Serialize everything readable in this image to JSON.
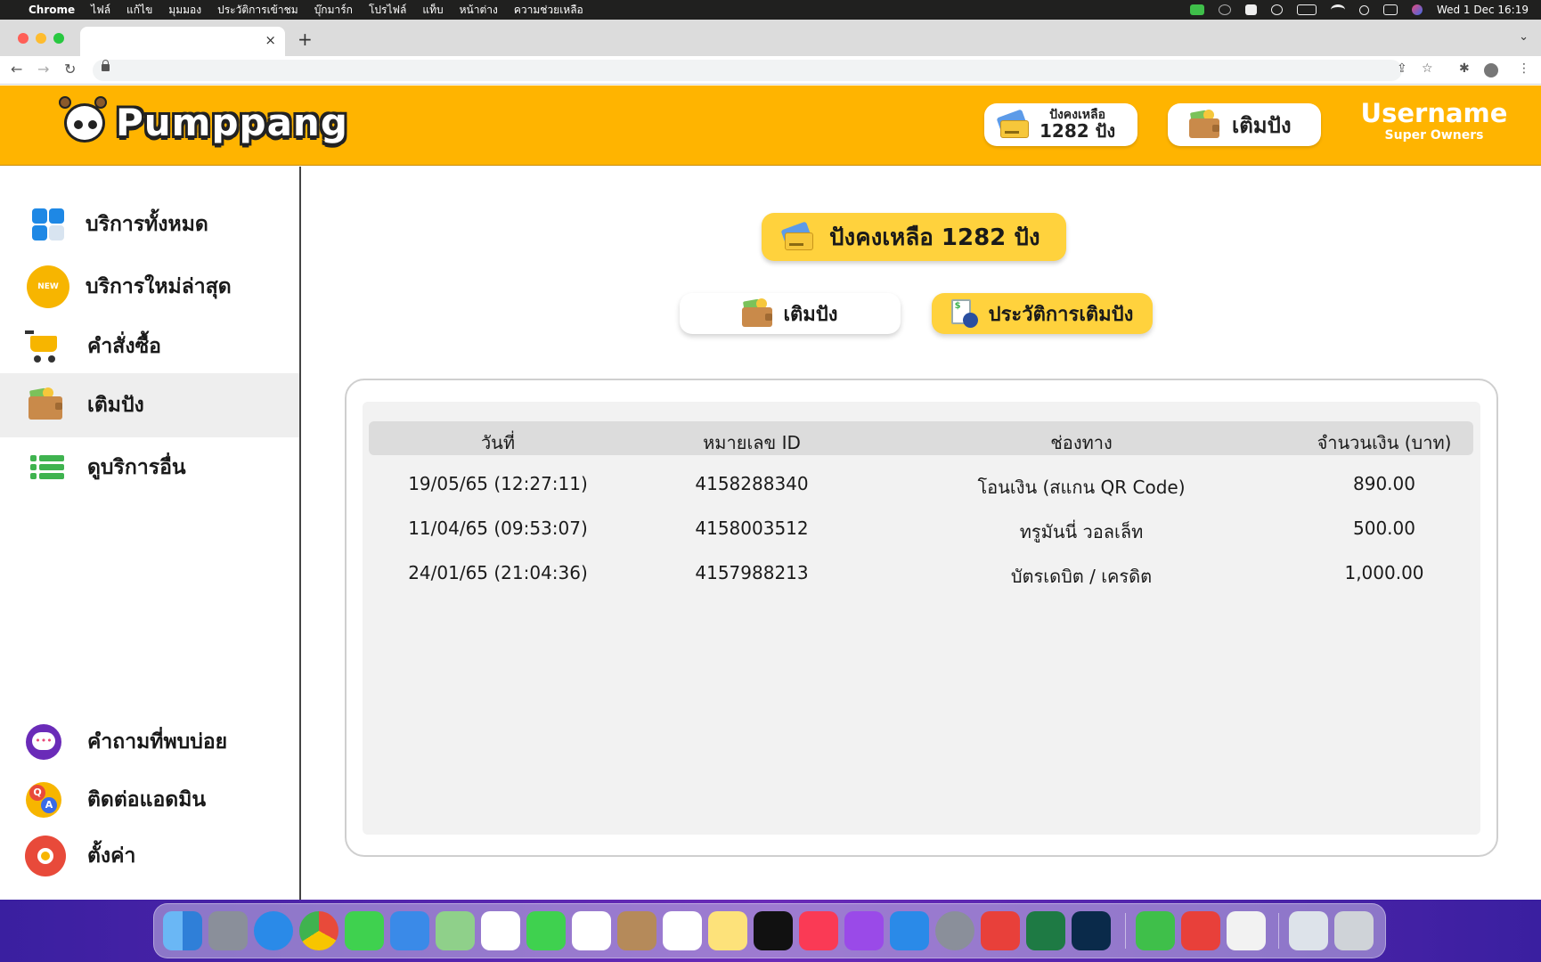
{
  "menubar": {
    "app_name": "Chrome",
    "items": [
      "ไฟล์",
      "แก้ไข",
      "มุมมอง",
      "ประวัติการเข้าชม",
      "บุ๊กมาร์ก",
      "โปรไฟล์",
      "แท็บ",
      "หน้าต่าง",
      "ความช่วยเหลือ"
    ],
    "clock": "Wed 1 Dec  16:19"
  },
  "browser": {
    "tab_close": "×",
    "new_tab": "+"
  },
  "header": {
    "logo_text": "Pumppang",
    "balance_label": "ปังคงเหลือ",
    "balance_value": "1282 ปัง",
    "topup_label": "เติมปัง",
    "username": "Username",
    "role": "Super Owners"
  },
  "sidebar": {
    "items": [
      {
        "label": "บริการทั้งหมด",
        "icon": "grid-icon"
      },
      {
        "label": "บริการใหม่ล่าสุด",
        "icon": "new-badge-icon",
        "badge": "NEW"
      },
      {
        "label": "คำสั่งซื้อ",
        "icon": "cart-icon"
      },
      {
        "label": "เติมปัง",
        "icon": "wallet-icon",
        "active": true
      },
      {
        "label": "ดูบริการอื่น",
        "icon": "list-icon"
      }
    ],
    "bottom_items": [
      {
        "label": "คำถามที่พบบ่อย",
        "icon": "faq-icon"
      },
      {
        "label": "ติดต่อแอดมิน",
        "icon": "qa-icon",
        "q": "Q",
        "a": "A"
      },
      {
        "label": "ตั้งค่า",
        "icon": "gear-icon"
      }
    ]
  },
  "main": {
    "balance_banner": "ปังคงเหลือ  1282  ปัง",
    "tabs": [
      {
        "label": "เติมปัง",
        "active": false
      },
      {
        "label": "ประวัติการเติมปัง",
        "active": true
      }
    ],
    "table": {
      "headers": [
        "วันที่",
        "หมายเลข ID",
        "ช่องทาง",
        "จำนวนเงิน (บาท)"
      ],
      "rows": [
        [
          "19/05/65  (12:27:11)",
          "4158288340",
          "โอนเงิน (สแกน QR Code)",
          "890.00"
        ],
        [
          "11/04/65  (09:53:07)",
          "4158003512",
          "ทรูมันนี่ วอลเล็ท",
          "500.00"
        ],
        [
          "24/01/65  (21:04:36)",
          "4157988213",
          "บัตรเดบิต / เครดิต",
          "1,000.00"
        ]
      ]
    }
  },
  "colors": {
    "brand": "#ffb400",
    "accent": "#ffd23d",
    "active_row": "#eeeeee"
  }
}
